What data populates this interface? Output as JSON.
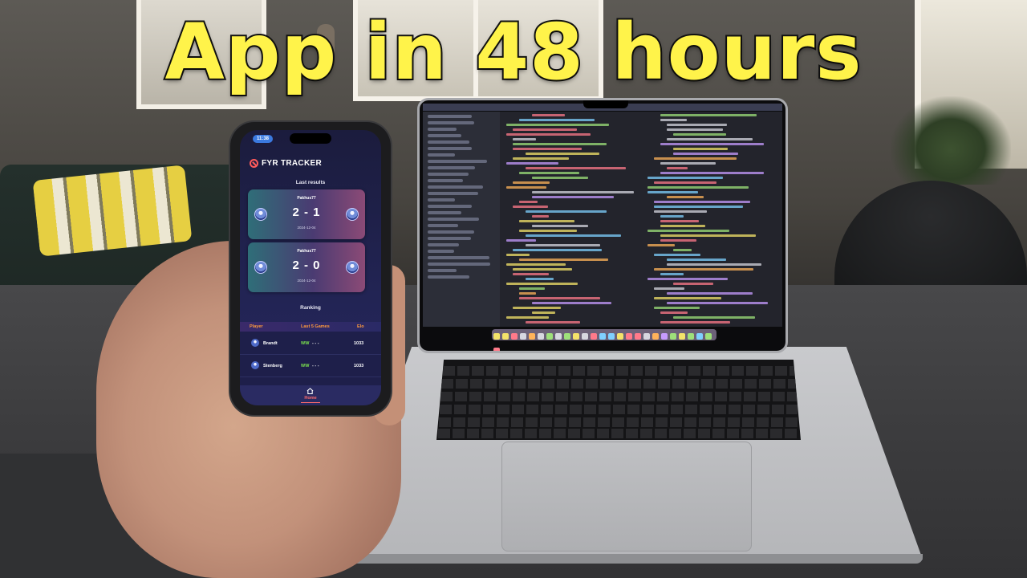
{
  "headline": "App in 48 hours",
  "phone_app": {
    "status_time": "11:38",
    "app_title": "FYR TRACKER",
    "brand_icon": "no-entry-icon",
    "last_results_title": "Last results",
    "matches": [
      {
        "player": "Pakhus77",
        "score": "2 - 1",
        "date": "2024-12-04"
      },
      {
        "player": "Pakhus77",
        "score": "2 - 0",
        "date": "2024-12-04"
      }
    ],
    "ranking_title": "Ranking",
    "ranking_columns": {
      "player": "Player",
      "last_games": "Last 5 Games",
      "elo": "Elo"
    },
    "ranking_rows": [
      {
        "name": "Brandt",
        "form_wins": "WW",
        "form_rest": "- - -",
        "elo": "1033"
      },
      {
        "name": "Stenberg",
        "form_wins": "WW",
        "form_rest": "- - -",
        "elo": "1033"
      }
    ],
    "tab_home": "Home",
    "colors": {
      "accent": "#ff6b6b",
      "header_text": "#ff9b3d",
      "win": "#7be34e",
      "headline": "#fff34a"
    }
  }
}
